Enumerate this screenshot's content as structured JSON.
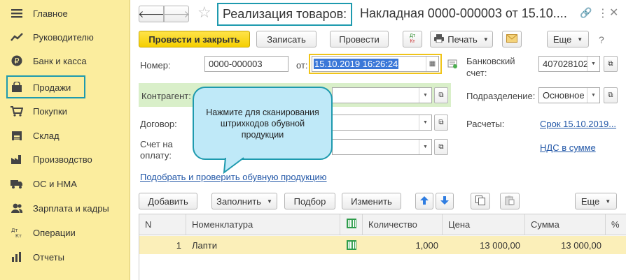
{
  "sidebar": {
    "items": [
      {
        "label": "Главное",
        "icon": "menu-icon"
      },
      {
        "label": "Руководителю",
        "icon": "chart-trend-icon"
      },
      {
        "label": "Банк и касса",
        "icon": "coin-icon"
      },
      {
        "label": "Продажи",
        "icon": "shopping-bag-icon"
      },
      {
        "label": "Покупки",
        "icon": "cart-icon"
      },
      {
        "label": "Склад",
        "icon": "warehouse-icon"
      },
      {
        "label": "Производство",
        "icon": "factory-icon"
      },
      {
        "label": "ОС и НМА",
        "icon": "truck-icon"
      },
      {
        "label": "Зарплата и кадры",
        "icon": "people-icon"
      },
      {
        "label": "Операции",
        "icon": "debit-credit-icon"
      },
      {
        "label": "Отчеты",
        "icon": "report-icon"
      }
    ]
  },
  "header": {
    "title": "Реализация товаров:",
    "subtitle": "Накладная 0000-000003 от 15.10...."
  },
  "toolbar": {
    "post_close": "Провести и закрыть",
    "save": "Записать",
    "post": "Провести",
    "dtkt_top": "Дт",
    "dtkt_bottom": "Кт",
    "print": "Печать",
    "more": "Еще"
  },
  "form": {
    "number_label": "Номер:",
    "number_value": "0000-000003",
    "date_label": "от:",
    "date_value": "15.10.2019 16:26:24",
    "bank_label_1": "Банковский",
    "bank_label_2": "счет:",
    "bank_value": "407028102",
    "contractor_label": "Контрагент:",
    "department_label": "Подразделение:",
    "department_value": "Основное",
    "contract_label": "Договор:",
    "settlements_label": "Расчеты:",
    "settlements_link": "Срок 15.10.2019...",
    "invoice_label_1": "Счет на",
    "invoice_label_2": "оплату:",
    "vat_link": "НДС в сумме",
    "pick_link": "Подобрать и проверить обувную продукцию"
  },
  "callout": {
    "text": "Нажмите для сканирования штрихкодов обувной продукции"
  },
  "table_toolbar": {
    "add": "Добавить",
    "fill": "Заполнить",
    "pick": "Подбор",
    "change": "Изменить",
    "more": "Еще"
  },
  "table": {
    "headers": [
      "N",
      "Номенклатура",
      "Количество",
      "Цена",
      "Сумма",
      "%"
    ],
    "rows": [
      {
        "n": "1",
        "item": "Лапти",
        "qty": "1,000",
        "price": "13 000,00",
        "sum": "13 000,00"
      }
    ]
  }
}
